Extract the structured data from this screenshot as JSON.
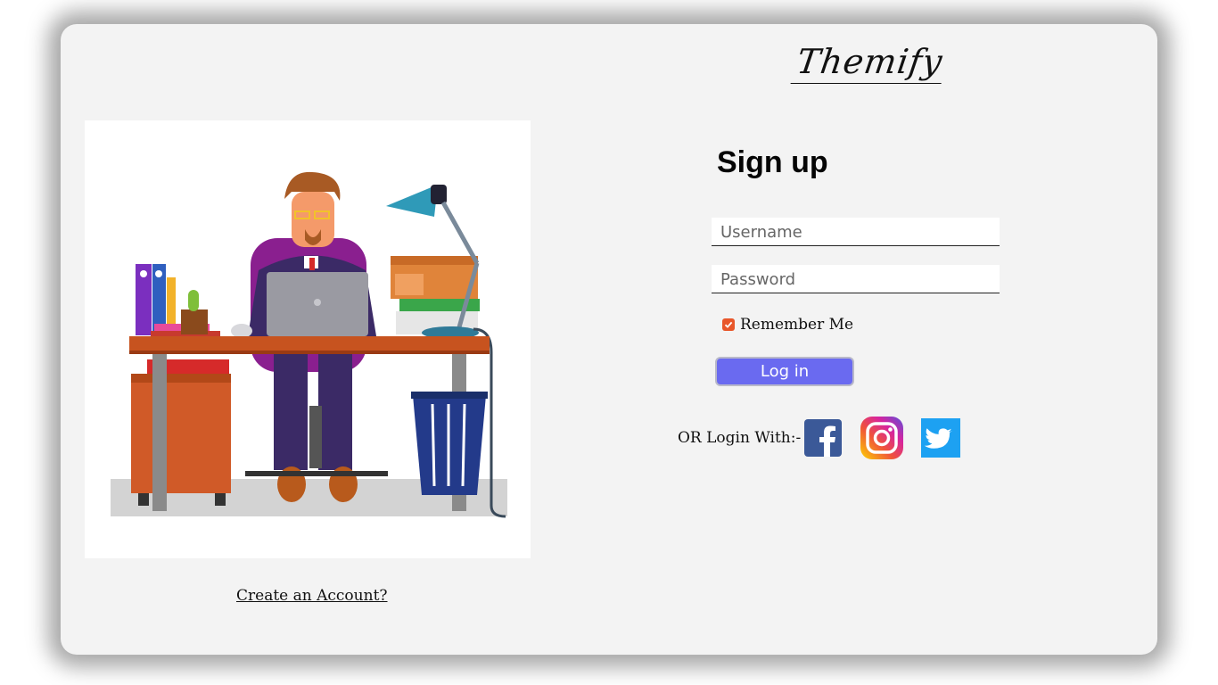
{
  "brand": {
    "name": "Themify"
  },
  "illustration": {
    "subject": "office-worker-at-desk-illustration"
  },
  "links": {
    "create_account": "Create an Account?"
  },
  "form": {
    "title": "Sign up",
    "username_placeholder": "Username",
    "password_placeholder": "Password",
    "remember_label": "Remember Me",
    "remember_checked": true,
    "login_label": "Log in"
  },
  "social": {
    "label": "OR Login With:-",
    "items": [
      {
        "name": "facebook",
        "icon": "facebook-icon",
        "color": "#3b5998"
      },
      {
        "name": "instagram",
        "icon": "instagram-icon",
        "color": "#e1306c"
      },
      {
        "name": "twitter",
        "icon": "twitter-icon",
        "color": "#1da1f2"
      }
    ]
  },
  "colors": {
    "card_bg": "#f3f3f3",
    "button_bg": "#6a6af0",
    "checkbox": "#e8572a"
  }
}
